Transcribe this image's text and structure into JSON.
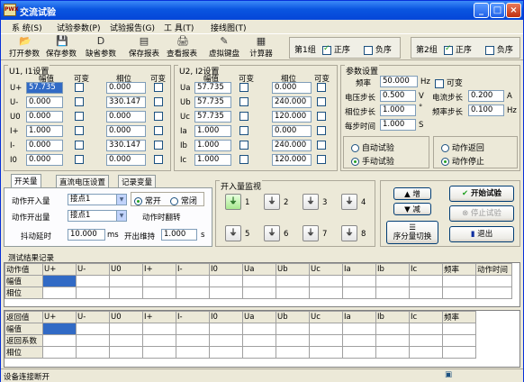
{
  "window": {
    "title": "交流试验",
    "icon_text": "PWX"
  },
  "menu": [
    "系 统(S)",
    "试验参数(P)",
    "试验报告(G)",
    "工 具(T)",
    "接线图(T)"
  ],
  "toolbar": {
    "open": "打开参数",
    "save": "保存参数",
    "default": "缺省参数",
    "save_report": "保存报表",
    "view_report": "查看报表",
    "keyboard": "虚拟键盘",
    "calc": "计算器"
  },
  "group1": {
    "label": "第1组",
    "pos": "正序",
    "neg": "负序"
  },
  "group2": {
    "label": "第2组",
    "pos": "正序",
    "neg": "负序"
  },
  "vi1": {
    "title": "U1, I1设置",
    "h_amp": "幅值",
    "h_var": "可变",
    "h_phase": "相位",
    "h_var2": "可变",
    "rows": [
      {
        "n": "U+",
        "a": "57.735",
        "p": "0.000"
      },
      {
        "n": "U-",
        "a": "0.000",
        "p": "330.147"
      },
      {
        "n": "U0",
        "a": "0.000",
        "p": "0.000"
      },
      {
        "n": "I+",
        "a": "1.000",
        "p": "0.000"
      },
      {
        "n": "I-",
        "a": "0.000",
        "p": "330.147"
      },
      {
        "n": "I0",
        "a": "0.000",
        "p": "0.000"
      }
    ]
  },
  "vi2": {
    "title": "U2, I2设置",
    "h_amp": "幅值",
    "h_var": "可变",
    "h_phase": "相位",
    "h_var2": "可变",
    "rows": [
      {
        "n": "Ua",
        "a": "57.735",
        "p": "0.000"
      },
      {
        "n": "Ub",
        "a": "57.735",
        "p": "240.000"
      },
      {
        "n": "Uc",
        "a": "57.735",
        "p": "120.000"
      },
      {
        "n": "Ia",
        "a": "1.000",
        "p": "0.000"
      },
      {
        "n": "Ib",
        "a": "1.000",
        "p": "240.000"
      },
      {
        "n": "Ic",
        "a": "1.000",
        "p": "120.000"
      }
    ]
  },
  "params": {
    "title": "参数设置",
    "freq_l": "频率",
    "freq": "50.000",
    "hz": "Hz",
    "var": "可变",
    "vstep_l": "电压步长",
    "vstep": "0.500",
    "v": "V",
    "istep_l": "电流步长",
    "istep": "0.200",
    "a": "A",
    "pstep_l": "相位步长",
    "pstep": "1.000",
    "deg": "°",
    "fstep_l": "频率步长",
    "fstep": "0.100",
    "hz2": "Hz",
    "tstep_l": "每步时间",
    "tstep": "1.000",
    "s": "S",
    "auto": "自动试验",
    "manual": "手动试验",
    "ret": "动作返回",
    "stop": "动作停止"
  },
  "tabs": [
    "开关量",
    "直流电压设置",
    "记录变量"
  ],
  "binary": {
    "in_l": "动作开入量",
    "in": "接点1",
    "out_l": "动作开出量",
    "out": "接点1",
    "no": "常开",
    "nc": "常闭",
    "flip": "动作时翻转",
    "db_l": "抖动延时",
    "db": "10.000",
    "ms": "ms",
    "hold_l": "开出维持",
    "hold": "1.000",
    "s": "s"
  },
  "monitor": {
    "title": "开入量监视",
    "items": [
      "1",
      "2",
      "3",
      "4",
      "5",
      "6",
      "7",
      "8"
    ]
  },
  "ctrl": {
    "inc": "增",
    "dec": "减",
    "seq": "序分量切换",
    "start": "开始试验",
    "stop": "停止试验",
    "exit": "退出"
  },
  "results": {
    "title": "测试结果记录",
    "t1_head": [
      "动作值",
      "U+",
      "U-",
      "U0",
      "I+",
      "I-",
      "I0",
      "Ua",
      "Ub",
      "Uc",
      "Ia",
      "Ib",
      "Ic",
      "频率",
      "动作时间"
    ],
    "t1_rows": [
      "幅值",
      "相位"
    ],
    "t2_head": [
      "返回值",
      "U+",
      "U-",
      "U0",
      "I+",
      "I-",
      "I0",
      "Ua",
      "Ub",
      "Uc",
      "Ia",
      "Ib",
      "Ic",
      "频率"
    ],
    "t2_rows": [
      "幅值",
      "返回系数",
      "相位"
    ]
  },
  "status": "设备连接断开"
}
